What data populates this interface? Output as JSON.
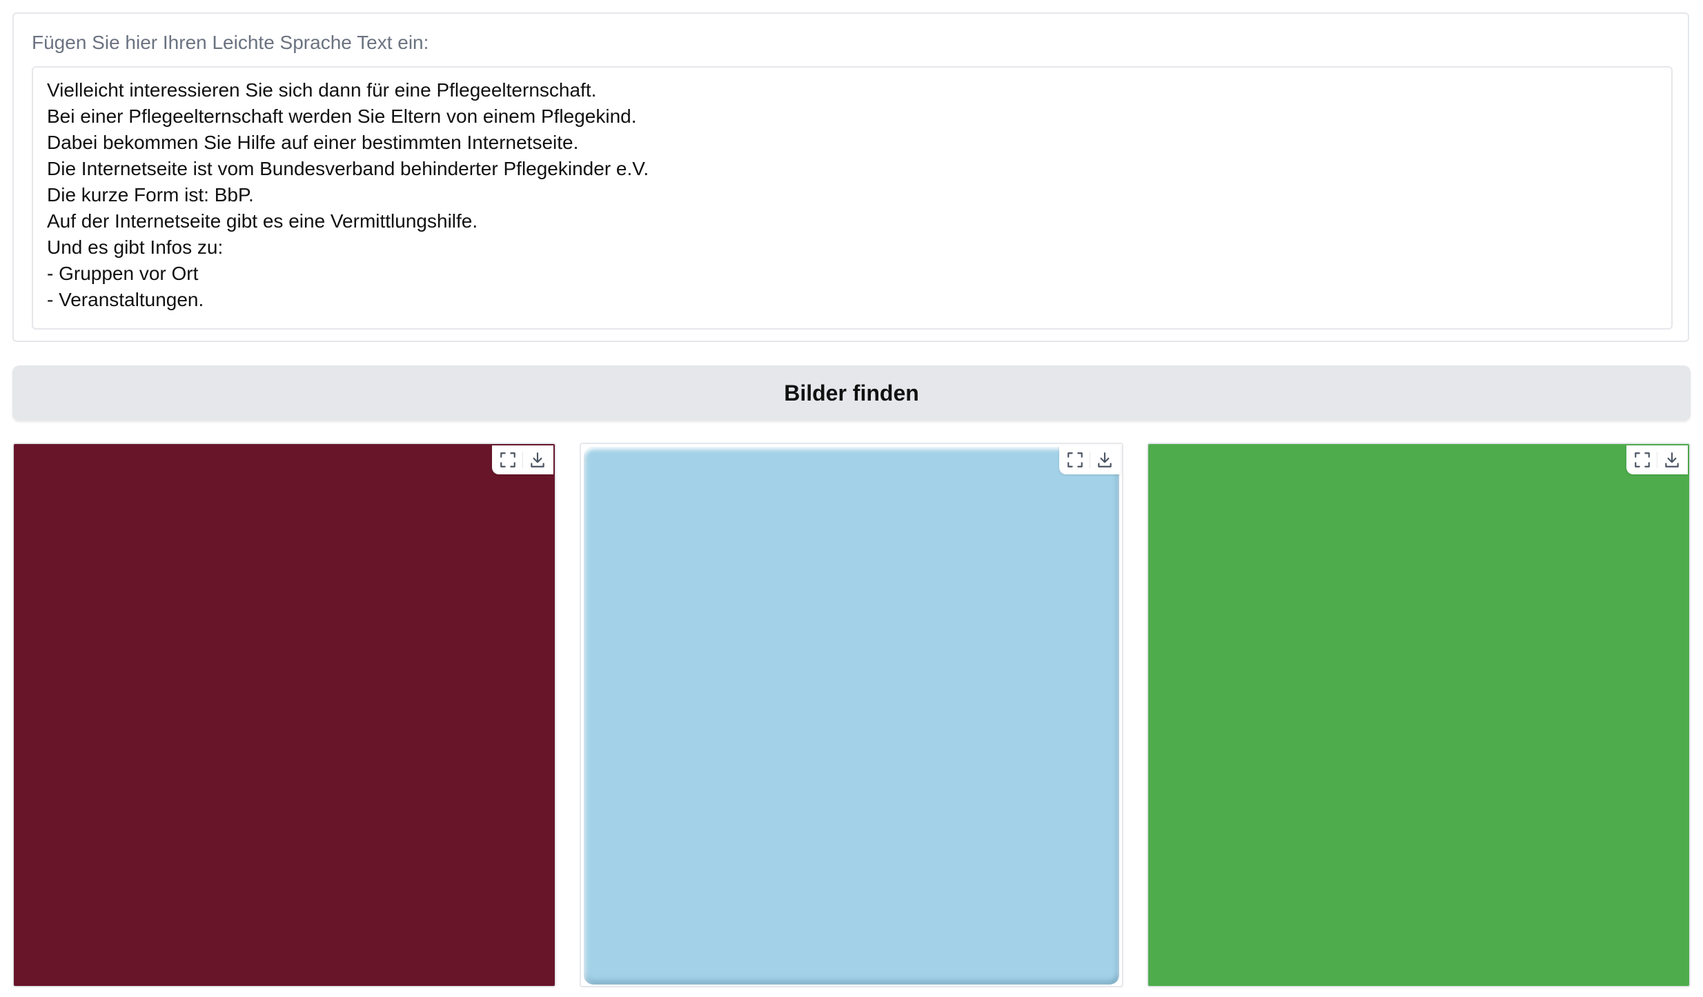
{
  "input": {
    "label": "Fügen Sie hier Ihren Leichte Sprache Text ein:",
    "lines": [
      "Vielleicht interessieren Sie sich dann für eine Pflegeelternschaft.",
      "Bei einer Pflegeelternschaft werden Sie Eltern von einem Pflegekind.",
      "Dabei bekommen Sie Hilfe auf einer bestimmten Internetseite.",
      "Die Internetseite ist vom Bundesverband behinderter Pflegekinder e.V.",
      "Die kurze Form ist: BbP.",
      "Auf der Internetseite gibt es eine Vermittlungshilfe.",
      "Und es gibt Infos zu:",
      "- Gruppen vor Ort",
      "- Veranstaltungen."
    ]
  },
  "button": {
    "label": "Bilder finden"
  },
  "gallery": {
    "images": [
      {
        "color": "#68152a",
        "icons": [
          "fullscreen-icon",
          "download-icon"
        ]
      },
      {
        "color": "#a3d2e8",
        "icons": [
          "fullscreen-icon",
          "download-icon"
        ]
      },
      {
        "color": "#4fac4d",
        "icons": [
          "fullscreen-icon",
          "download-icon"
        ]
      }
    ]
  }
}
